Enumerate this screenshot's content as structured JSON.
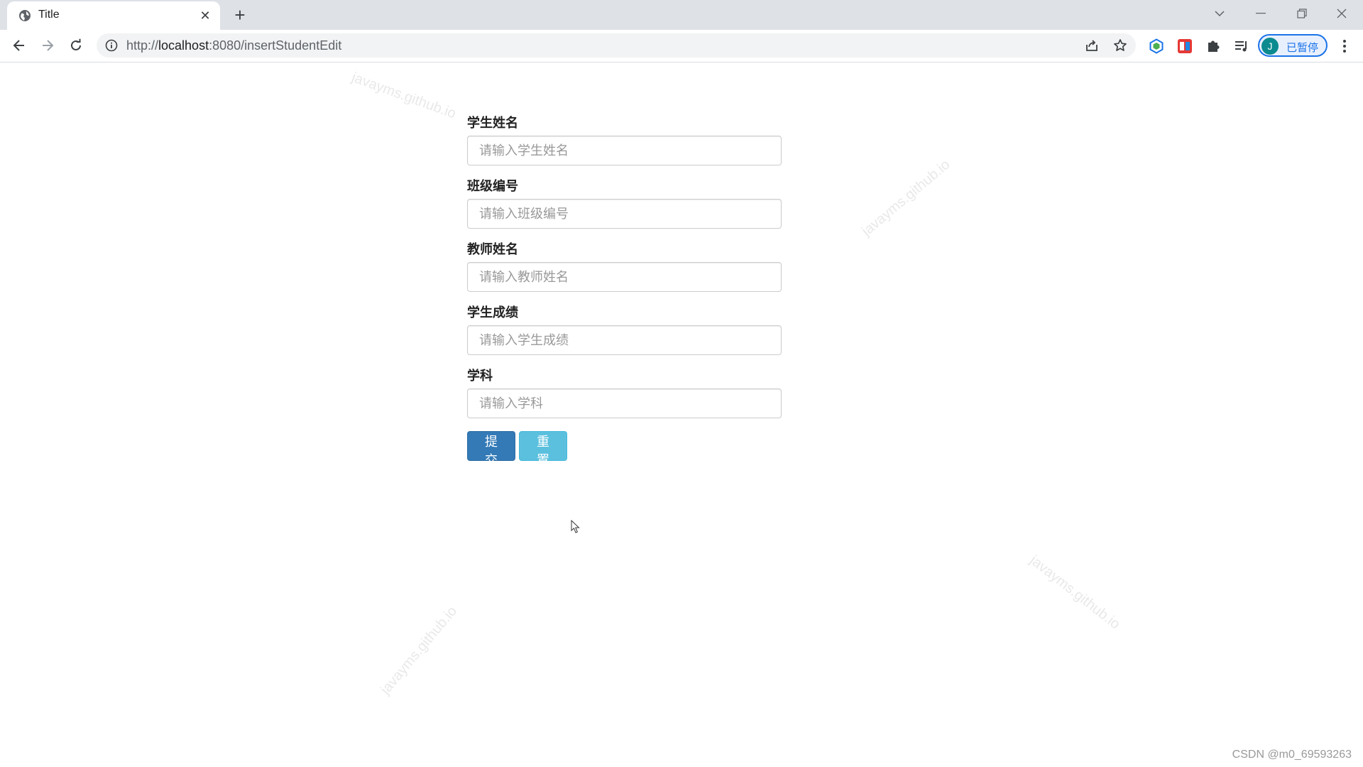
{
  "browser": {
    "tab": {
      "title": "Title"
    },
    "address": {
      "scheme": "http://",
      "host": "localhost",
      "rest": ":8080/insertStudentEdit"
    },
    "profile": {
      "initial": "J",
      "label": "已暂停"
    }
  },
  "form": {
    "fields": [
      {
        "label": "学生姓名",
        "placeholder": "请输入学生姓名"
      },
      {
        "label": "班级编号",
        "placeholder": "请输入班级编号"
      },
      {
        "label": "教师姓名",
        "placeholder": "请输入教师姓名"
      },
      {
        "label": "学生成绩",
        "placeholder": "请输入学生成绩"
      },
      {
        "label": "学科",
        "placeholder": "请输入学科"
      }
    ],
    "submit_label": "提交",
    "reset_label": "重置"
  },
  "watermark_text": "javayms.github.io",
  "footer": {
    "credit": "CSDN @m0_69593263"
  },
  "colors": {
    "primary": "#337ab7",
    "info": "#5bc0de",
    "tabstrip": "#dee1e6",
    "profile": "#1a73e8"
  }
}
